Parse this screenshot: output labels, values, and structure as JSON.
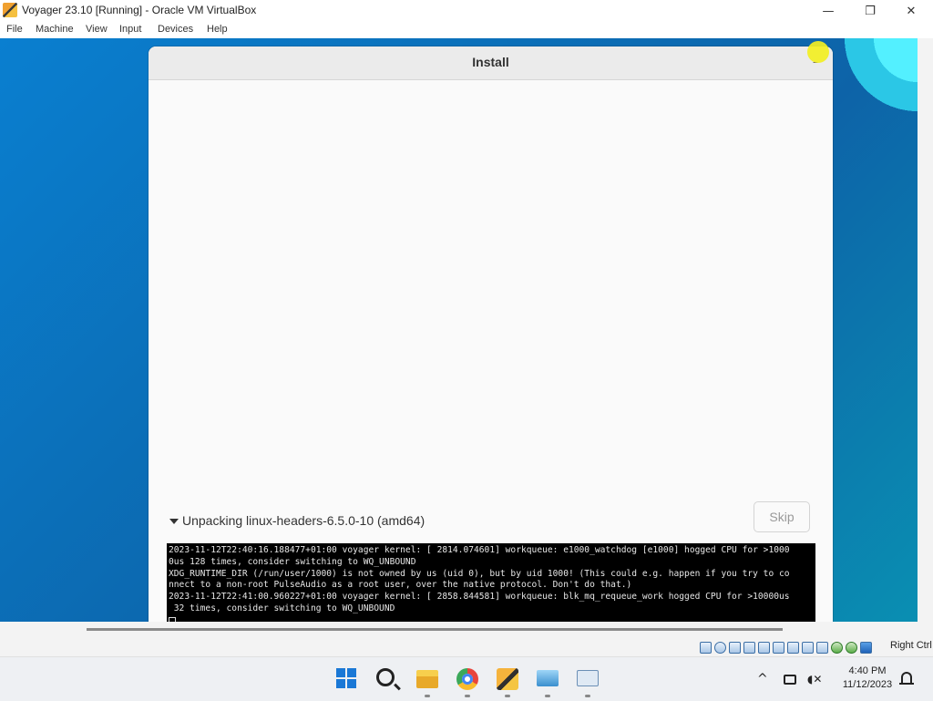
{
  "window": {
    "title": "Voyager 23.10 [Running] - Oracle VM VirtualBox",
    "minimize_glyph": "—",
    "maximize_glyph": "❐",
    "close_glyph": "✕"
  },
  "menubar": {
    "items": [
      "File",
      "Machine",
      "View",
      "Input",
      "Devices",
      "Help"
    ]
  },
  "installer": {
    "title": "Install",
    "minimize_glyph": "–",
    "progress_label": "Unpacking linux-headers-6.5.0-10 (amd64)",
    "skip_label": "Skip",
    "log_lines": [
      "2023-11-12T22:40:16.188477+01:00 voyager kernel: [ 2814.074601] workqueue: e1000_watchdog [e1000] hogged CPU for >1000",
      "0us 128 times, consider switching to WQ_UNBOUND",
      "XDG_RUNTIME_DIR (/run/user/1000) is not owned by us (uid 0), but by uid 1000! (This could e.g. happen if you try to co",
      "nnect to a non-root PulseAudio as a root user, over the native protocol. Don't do that.)",
      "2023-11-12T22:41:00.960227+01:00 voyager kernel: [ 2858.844581] workqueue: blk_mq_requeue_work hogged CPU for >10000us",
      " 32 times, consider switching to WQ_UNBOUND"
    ]
  },
  "status": {
    "host_key": "Right Ctrl",
    "icons": [
      "hard-disk-icon",
      "optical-drive-icon",
      "audio-icon",
      "network-icon",
      "usb-icon",
      "shared-folders-icon",
      "display-icon",
      "video-capture-icon",
      "cpu-icon",
      "vt-x-icon",
      "mouse-integration-icon",
      "keyboard-icon"
    ]
  },
  "taskbar": {
    "apps": [
      "start",
      "search",
      "file-explorer",
      "chrome",
      "virtualbox",
      "remote-desktop",
      "resource-monitor"
    ],
    "tray_chevron": "^",
    "time": "4:40 PM",
    "date": "11/12/2023"
  },
  "colors": {
    "desktop_blue": "#0b6fb8",
    "terminal_bg": "#000000",
    "cursor_highlight": "#f2ef22"
  }
}
